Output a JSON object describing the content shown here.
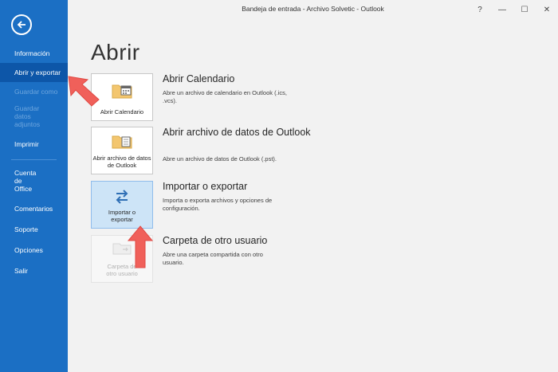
{
  "window": {
    "title": "Bandeja de entrada - Archivo Solvetic  -  Outlook",
    "help": "?",
    "minimize": "—",
    "maximize": "☐",
    "close": "✕"
  },
  "sidebar": {
    "items": [
      {
        "label": "Información"
      },
      {
        "label": "Abrir y exportar"
      },
      {
        "label": "Guardar como"
      },
      {
        "label": "Guardar datos adjuntos"
      },
      {
        "label": "Imprimir"
      },
      {
        "label": "Cuenta de Office"
      },
      {
        "label": "Comentarios"
      },
      {
        "label": "Soporte"
      },
      {
        "label": "Opciones"
      },
      {
        "label": "Salir"
      }
    ]
  },
  "main": {
    "heading": "Abrir",
    "options": [
      {
        "tile": "Abrir Calendario",
        "title": "Abrir Calendario",
        "desc": "Abre un archivo de calendario en Outlook (.ics, .vcs)."
      },
      {
        "tile": "Abrir archivo de datos de Outlook",
        "title": "Abrir archivo de datos de Outlook",
        "desc": "Abre un archivo de datos de Outlook (.pst)."
      },
      {
        "tile": "Importar o exportar",
        "title": "Importar o exportar",
        "desc": "Importa o exporta archivos y opciones de configuración."
      },
      {
        "tile": "Carpeta de otro usuario",
        "title": "Carpeta de otro usuario",
        "desc": "Abre una carpeta compartida con otro usuario."
      }
    ]
  },
  "colors": {
    "sidebar": "#1b6fc4",
    "sidebar_active": "#0d56a8",
    "selected_tile": "#cde4f7",
    "arrow": "#f0605a"
  },
  "icons": [
    "back-arrow-icon",
    "calendar-folder-icon",
    "data-file-folder-icon",
    "import-export-icon",
    "shared-folder-icon"
  ]
}
